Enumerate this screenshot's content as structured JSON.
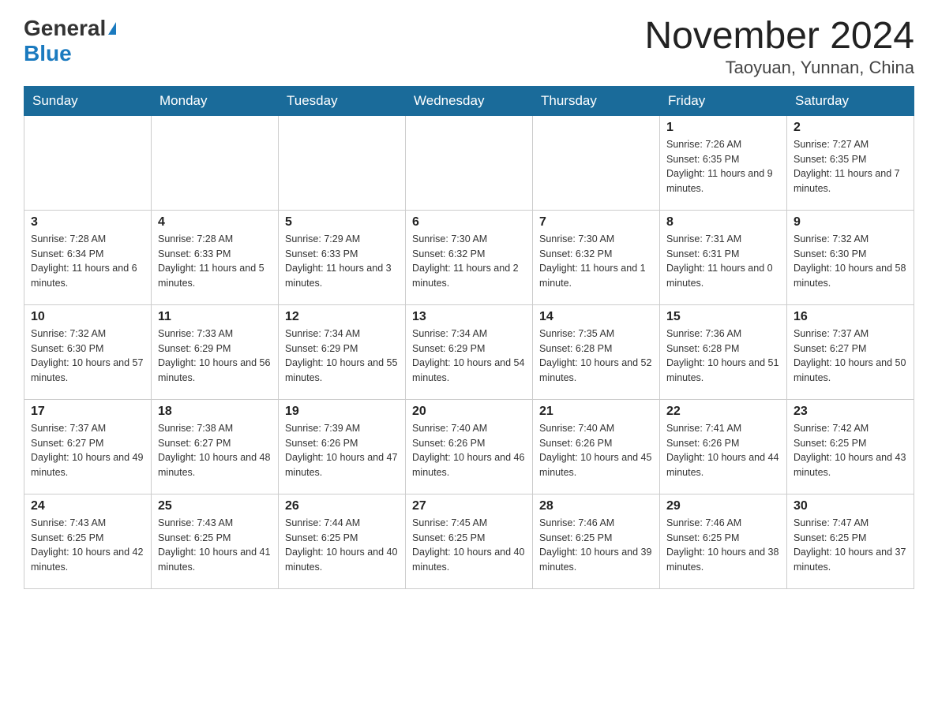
{
  "header": {
    "logo_general": "General",
    "logo_blue": "Blue",
    "title": "November 2024",
    "subtitle": "Taoyuan, Yunnan, China"
  },
  "calendar": {
    "days_of_week": [
      "Sunday",
      "Monday",
      "Tuesday",
      "Wednesday",
      "Thursday",
      "Friday",
      "Saturday"
    ],
    "weeks": [
      [
        {
          "day": "",
          "info": ""
        },
        {
          "day": "",
          "info": ""
        },
        {
          "day": "",
          "info": ""
        },
        {
          "day": "",
          "info": ""
        },
        {
          "day": "",
          "info": ""
        },
        {
          "day": "1",
          "info": "Sunrise: 7:26 AM\nSunset: 6:35 PM\nDaylight: 11 hours and 9 minutes."
        },
        {
          "day": "2",
          "info": "Sunrise: 7:27 AM\nSunset: 6:35 PM\nDaylight: 11 hours and 7 minutes."
        }
      ],
      [
        {
          "day": "3",
          "info": "Sunrise: 7:28 AM\nSunset: 6:34 PM\nDaylight: 11 hours and 6 minutes."
        },
        {
          "day": "4",
          "info": "Sunrise: 7:28 AM\nSunset: 6:33 PM\nDaylight: 11 hours and 5 minutes."
        },
        {
          "day": "5",
          "info": "Sunrise: 7:29 AM\nSunset: 6:33 PM\nDaylight: 11 hours and 3 minutes."
        },
        {
          "day": "6",
          "info": "Sunrise: 7:30 AM\nSunset: 6:32 PM\nDaylight: 11 hours and 2 minutes."
        },
        {
          "day": "7",
          "info": "Sunrise: 7:30 AM\nSunset: 6:32 PM\nDaylight: 11 hours and 1 minute."
        },
        {
          "day": "8",
          "info": "Sunrise: 7:31 AM\nSunset: 6:31 PM\nDaylight: 11 hours and 0 minutes."
        },
        {
          "day": "9",
          "info": "Sunrise: 7:32 AM\nSunset: 6:30 PM\nDaylight: 10 hours and 58 minutes."
        }
      ],
      [
        {
          "day": "10",
          "info": "Sunrise: 7:32 AM\nSunset: 6:30 PM\nDaylight: 10 hours and 57 minutes."
        },
        {
          "day": "11",
          "info": "Sunrise: 7:33 AM\nSunset: 6:29 PM\nDaylight: 10 hours and 56 minutes."
        },
        {
          "day": "12",
          "info": "Sunrise: 7:34 AM\nSunset: 6:29 PM\nDaylight: 10 hours and 55 minutes."
        },
        {
          "day": "13",
          "info": "Sunrise: 7:34 AM\nSunset: 6:29 PM\nDaylight: 10 hours and 54 minutes."
        },
        {
          "day": "14",
          "info": "Sunrise: 7:35 AM\nSunset: 6:28 PM\nDaylight: 10 hours and 52 minutes."
        },
        {
          "day": "15",
          "info": "Sunrise: 7:36 AM\nSunset: 6:28 PM\nDaylight: 10 hours and 51 minutes."
        },
        {
          "day": "16",
          "info": "Sunrise: 7:37 AM\nSunset: 6:27 PM\nDaylight: 10 hours and 50 minutes."
        }
      ],
      [
        {
          "day": "17",
          "info": "Sunrise: 7:37 AM\nSunset: 6:27 PM\nDaylight: 10 hours and 49 minutes."
        },
        {
          "day": "18",
          "info": "Sunrise: 7:38 AM\nSunset: 6:27 PM\nDaylight: 10 hours and 48 minutes."
        },
        {
          "day": "19",
          "info": "Sunrise: 7:39 AM\nSunset: 6:26 PM\nDaylight: 10 hours and 47 minutes."
        },
        {
          "day": "20",
          "info": "Sunrise: 7:40 AM\nSunset: 6:26 PM\nDaylight: 10 hours and 46 minutes."
        },
        {
          "day": "21",
          "info": "Sunrise: 7:40 AM\nSunset: 6:26 PM\nDaylight: 10 hours and 45 minutes."
        },
        {
          "day": "22",
          "info": "Sunrise: 7:41 AM\nSunset: 6:26 PM\nDaylight: 10 hours and 44 minutes."
        },
        {
          "day": "23",
          "info": "Sunrise: 7:42 AM\nSunset: 6:25 PM\nDaylight: 10 hours and 43 minutes."
        }
      ],
      [
        {
          "day": "24",
          "info": "Sunrise: 7:43 AM\nSunset: 6:25 PM\nDaylight: 10 hours and 42 minutes."
        },
        {
          "day": "25",
          "info": "Sunrise: 7:43 AM\nSunset: 6:25 PM\nDaylight: 10 hours and 41 minutes."
        },
        {
          "day": "26",
          "info": "Sunrise: 7:44 AM\nSunset: 6:25 PM\nDaylight: 10 hours and 40 minutes."
        },
        {
          "day": "27",
          "info": "Sunrise: 7:45 AM\nSunset: 6:25 PM\nDaylight: 10 hours and 40 minutes."
        },
        {
          "day": "28",
          "info": "Sunrise: 7:46 AM\nSunset: 6:25 PM\nDaylight: 10 hours and 39 minutes."
        },
        {
          "day": "29",
          "info": "Sunrise: 7:46 AM\nSunset: 6:25 PM\nDaylight: 10 hours and 38 minutes."
        },
        {
          "day": "30",
          "info": "Sunrise: 7:47 AM\nSunset: 6:25 PM\nDaylight: 10 hours and 37 minutes."
        }
      ]
    ]
  }
}
